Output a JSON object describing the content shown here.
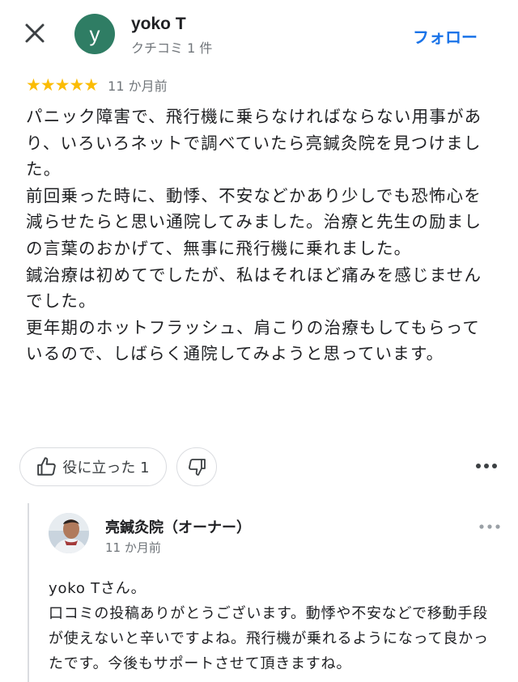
{
  "header": {
    "close_icon": "close-icon",
    "avatar_letter": "y",
    "avatar_color": "#2f7d64",
    "author_name": "yoko T",
    "author_meta": "クチコミ 1 件",
    "follow_label": "フォロー",
    "accent_color": "#1a73e8"
  },
  "review": {
    "rating": 5,
    "star_color": "#fbbc04",
    "date": "11 か月前",
    "paragraphs": [
      "パニック障害で、飛行機に乗らなければならない用事があり、いろいろネットで調べていたら亮鍼灸院を見つけました。",
      "前回乗った時に、動悸、不安などかあり少しでも恐怖心を減らせたらと思い通院してみました。治療と先生の励ましの言葉のおかげて、無事に飛行機に乗れました。",
      "鍼治療は初めてでしたが、私はそれほど痛みを感じませんでした。",
      "更年期のホットフラッシュ、肩こりの治療もしてもらっているので、しばらく通院してみようと思っています。"
    ]
  },
  "actions": {
    "helpful_label": "役に立った 1",
    "thumbs_up_icon": "thumbs-up-icon",
    "thumbs_down_icon": "thumbs-down-icon",
    "more_icon": "more-horizontal-icon"
  },
  "reply": {
    "owner_name": "亮鍼灸院（オーナー）",
    "date": "11 か月前",
    "paragraphs": [
      "yoko Tさん。",
      "口コミの投稿ありがとうございます。動悸や不安などで移動手段が使えないと辛いですよね。飛行機が乗れるようになって良かったです。今後もサポートさせて頂きますね。"
    ]
  }
}
